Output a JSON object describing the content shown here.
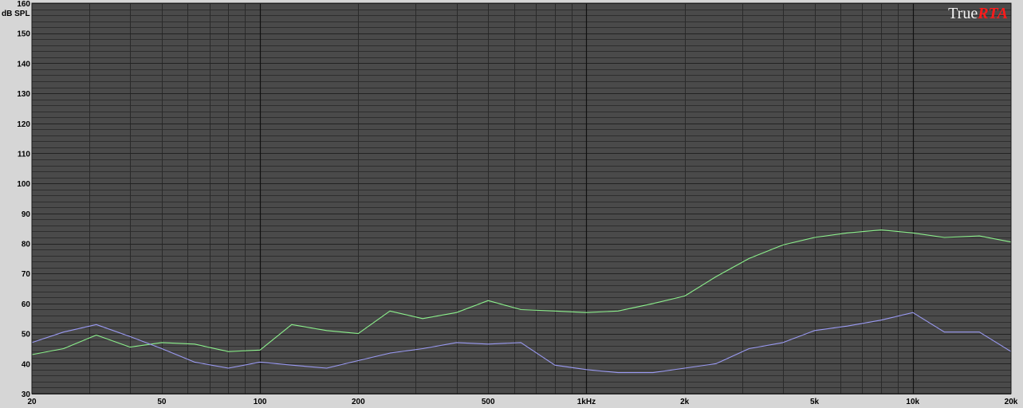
{
  "app": {
    "logo_part1": "True",
    "logo_part2": "RTA"
  },
  "chart_data": {
    "type": "line",
    "ylabel": "dB SPL",
    "xscale": "log",
    "xlim": [
      20,
      20000
    ],
    "ylim": [
      30,
      160
    ],
    "grid": true,
    "y_ticks": [
      30,
      40,
      50,
      60,
      70,
      80,
      90,
      100,
      110,
      120,
      130,
      140,
      150,
      160
    ],
    "x_ticks": [
      {
        "value": 20,
        "label": "20"
      },
      {
        "value": 50,
        "label": "50"
      },
      {
        "value": 100,
        "label": "100"
      },
      {
        "value": 200,
        "label": "200"
      },
      {
        "value": 500,
        "label": "500"
      },
      {
        "value": 1000,
        "label": "1kHz"
      },
      {
        "value": 2000,
        "label": "2k"
      },
      {
        "value": 5000,
        "label": "5k"
      },
      {
        "value": 10000,
        "label": "10k"
      },
      {
        "value": 20000,
        "label": "20k"
      }
    ],
    "series": [
      {
        "color": "#8cf08c",
        "x": [
          20,
          25,
          31.5,
          40,
          50,
          63,
          80,
          100,
          125,
          160,
          200,
          250,
          315,
          400,
          500,
          630,
          800,
          1000,
          1250,
          1600,
          2000,
          2500,
          3150,
          4000,
          5000,
          6300,
          8000,
          10000,
          12500,
          16000,
          20000
        ],
        "y": [
          43,
          45,
          49.5,
          45.5,
          47,
          46.5,
          44,
          44.5,
          53,
          51,
          50,
          57.5,
          55,
          57,
          61,
          58,
          57.5,
          57,
          57.5,
          60,
          62.5,
          69,
          75,
          79.5,
          82,
          83.5,
          84.5,
          83.5,
          82,
          82.5,
          80.5
        ]
      },
      {
        "color": "#9a9af2",
        "x": [
          20,
          25,
          31.5,
          40,
          50,
          63,
          80,
          100,
          125,
          160,
          200,
          250,
          315,
          400,
          500,
          630,
          800,
          1000,
          1250,
          1600,
          2000,
          2500,
          3150,
          4000,
          5000,
          6300,
          8000,
          10000,
          12500,
          16000,
          20000
        ],
        "y": [
          47,
          50.5,
          53,
          49,
          45,
          40.5,
          38.5,
          40.5,
          39.5,
          38.5,
          41,
          43.5,
          45,
          47,
          46.5,
          47,
          39.5,
          38,
          37,
          37,
          38.5,
          40,
          45,
          47,
          51,
          52.5,
          54.5,
          57,
          50.5,
          50.5,
          44
        ]
      }
    ]
  }
}
